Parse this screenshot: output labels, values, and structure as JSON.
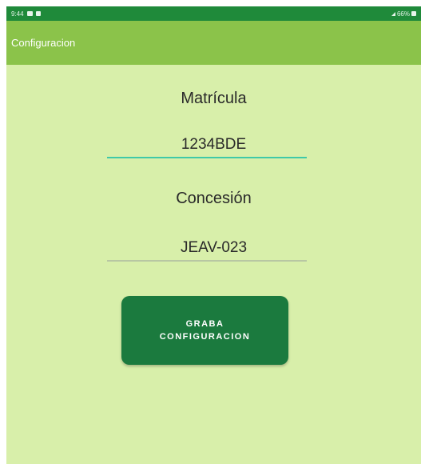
{
  "status_bar": {
    "time": "9:44",
    "right_text": "66%",
    "icons": [
      "image-icon",
      "sim-icon",
      "signal-icon",
      "battery-icon"
    ]
  },
  "app_bar": {
    "title": "Configuracion"
  },
  "form": {
    "plate_label": "Matrícula",
    "plate_value": "1234BDE",
    "concession_label": "Concesión",
    "concession_value": "JEAV-023"
  },
  "actions": {
    "save_label": "GRABA CONFIGURACION"
  },
  "colors": {
    "status_bar": "#1f8a3a",
    "app_bar": "#8bc34a",
    "background": "#d8efaa",
    "button": "#1b7a3e",
    "active_underline": "#3fc9a8",
    "inactive_underline": "#b8c7a3"
  }
}
